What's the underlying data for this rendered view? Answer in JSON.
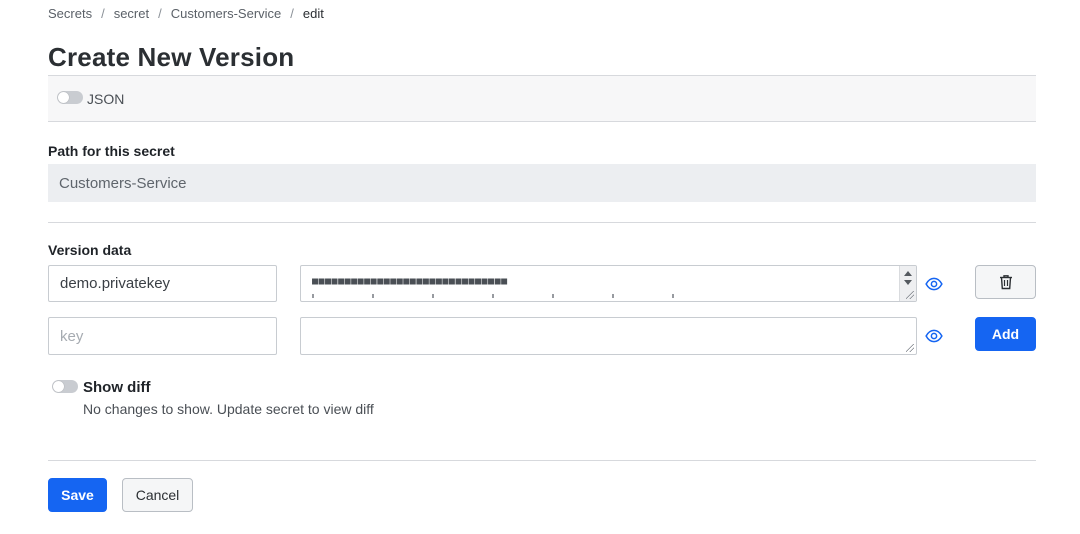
{
  "breadcrumb": [
    {
      "label": "Secrets"
    },
    {
      "label": "secret"
    },
    {
      "label": "Customers-Service"
    },
    {
      "label": "edit"
    }
  ],
  "page_title": "Create New Version",
  "json_toggle": {
    "label": "JSON",
    "on": false
  },
  "path": {
    "label": "Path for this secret",
    "value": "Customers-Service"
  },
  "version_data": {
    "label": "Version data",
    "rows": [
      {
        "key": "demo.privatekey",
        "value_masked": "■■■■■■■■■■■■■■■■■■■■■■■■■■■■■■"
      },
      {
        "key_placeholder": "key",
        "value": ""
      }
    ]
  },
  "buttons": {
    "add": "Add",
    "save": "Save",
    "cancel": "Cancel"
  },
  "show_diff": {
    "label": "Show diff",
    "on": false,
    "message": "No changes to show. Update secret to view diff"
  },
  "icons": {
    "eye": "eye-icon",
    "delete": "trash-icon"
  },
  "colors": {
    "primary": "#1565f2",
    "toggle_off": "#c9ccd1"
  }
}
